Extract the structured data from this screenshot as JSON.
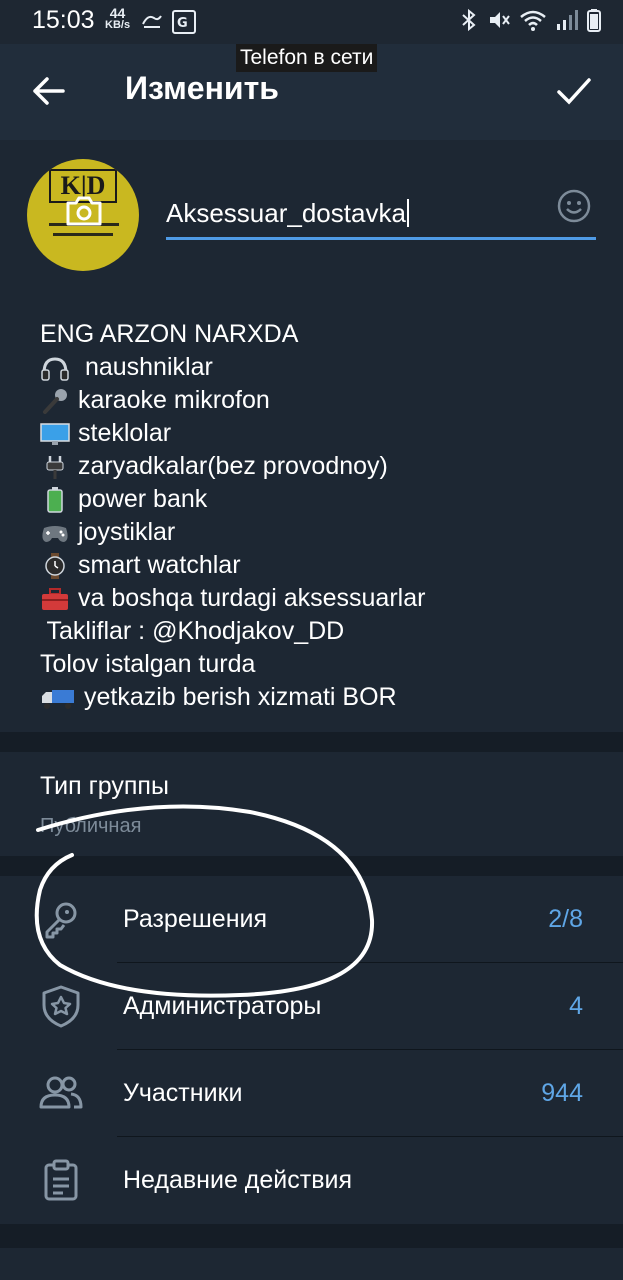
{
  "status_bar": {
    "time": "15:03",
    "speed_value": "44",
    "speed_unit": "KB/s"
  },
  "toast": "Telefon в сети",
  "header": {
    "title": "Изменить"
  },
  "profile": {
    "avatar_logo_text": "K|D",
    "name_value": "Aksessuar_dostavka"
  },
  "description": {
    "lines": [
      {
        "emoji": "none",
        "text": "ENG ARZON NARXDA"
      },
      {
        "emoji": "headphones-emoji",
        "text": " naushniklar"
      },
      {
        "emoji": "microphone-emoji",
        "text": "karaoke mikrofon"
      },
      {
        "emoji": "monitor-emoji",
        "text": "steklolar"
      },
      {
        "emoji": "plug-emoji",
        "text": "zaryadkalar(bez provodnoy)"
      },
      {
        "emoji": "battery-emoji",
        "text": "power bank"
      },
      {
        "emoji": "gamepad-emoji",
        "text": "joystiklar"
      },
      {
        "emoji": "watch-emoji",
        "text": "smart watchlar"
      },
      {
        "emoji": "toolbox-emoji",
        "text": "va boshqa turdagi aksessuarlar"
      },
      {
        "emoji": "none",
        "text": " Takliflar : @Khodjakov_DD"
      },
      {
        "emoji": "none",
        "text": "Tolov istalgan turda"
      },
      {
        "emoji": "truck-emoji",
        "text": "yetkazib berish xizmati BOR"
      }
    ]
  },
  "group_type": {
    "title": "Тип группы",
    "value": "Публичная"
  },
  "settings": [
    {
      "label": "Разрешения",
      "count": "2/8",
      "icon": "key-icon"
    },
    {
      "label": "Администраторы",
      "count": "4",
      "icon": "shield-star-icon"
    },
    {
      "label": "Участники",
      "count": "944",
      "icon": "users-icon"
    },
    {
      "label": "Недавние действия",
      "count": "",
      "icon": "clipboard-icon"
    }
  ],
  "colors": {
    "accent": "#4f9be6",
    "count": "#5fa6e6",
    "background": "#1d2733",
    "header": "#212d3b"
  }
}
